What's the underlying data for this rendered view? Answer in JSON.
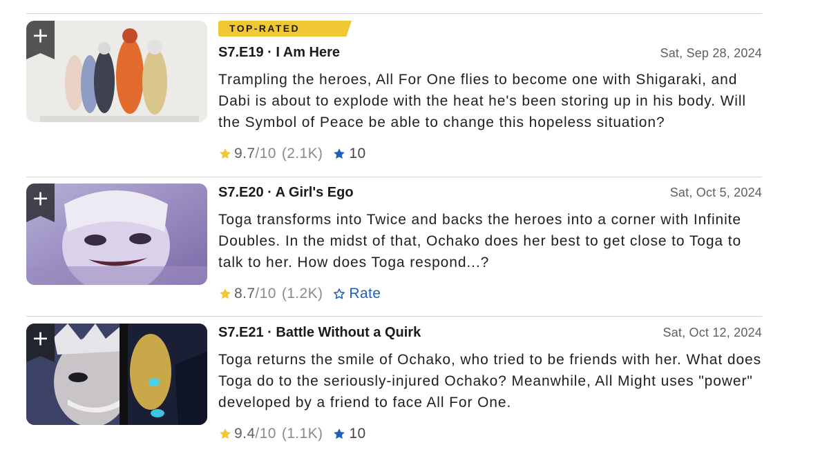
{
  "badge": {
    "top_rated": "TOP-RATED"
  },
  "episodes": [
    {
      "title": "S7.E19 · I Am Here",
      "date": "Sat, Sep 28, 2024",
      "description": "Trampling the heroes, All For One flies to become one with Shigaraki, and Dabi is about to explode with the heat he's been storing up in his body. Will the Symbol of Peace be able to change this hopeless situation?",
      "rating": "9.7",
      "rating_scale": "/10",
      "vote_count": "(2.1K)",
      "user_rating": "10"
    },
    {
      "title": "S7.E20 · A Girl's Ego",
      "date": "Sat, Oct 5, 2024",
      "description": "Toga transforms into Twice and backs the heroes into a corner with Infinite Doubles. In the midst of that, Ochako does her best to get close to Toga to talk to her. How does Toga respond...?",
      "rating": "8.7",
      "rating_scale": "/10",
      "vote_count": "(1.2K)",
      "user_rating_label": "Rate"
    },
    {
      "title": "S7.E21 · Battle Without a Quirk",
      "date": "Sat, Oct 12, 2024",
      "description": "Toga returns the smile of Ochako, who tried to be friends with her. What does Toga do to the seriously-injured Ochako? Meanwhile, All Might uses \"power\" developed by a friend to face All For One.",
      "rating": "9.4",
      "rating_scale": "/10",
      "vote_count": "(1.1K)",
      "user_rating": "10"
    }
  ],
  "colors": {
    "badge": "#f0c735",
    "star_rating": "#f0c735",
    "star_user": "#1f5fbd",
    "link": "#1f5fbd"
  },
  "icons": [
    "add-to-watchlist-icon",
    "star-filled-icon",
    "star-outline-icon"
  ]
}
